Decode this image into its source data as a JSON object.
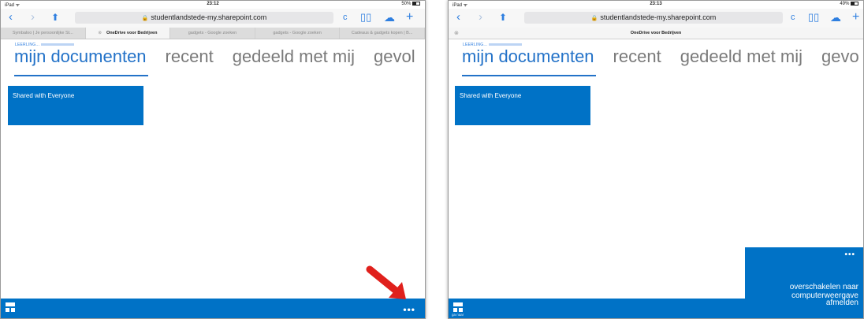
{
  "left": {
    "status": {
      "carrier": "iPad ᯤ",
      "time": "23:12",
      "battery": "50%"
    },
    "url": "studentlandstede-my.sharepoint.com",
    "tabs": [
      {
        "label": "Symbaloo | Je persoonlijke St...",
        "active": false
      },
      {
        "label": "OneDrive voor Bedrijven",
        "active": true
      },
      {
        "label": "gadgets - Google zoeken",
        "active": false
      },
      {
        "label": "gadgets - Google zoeken",
        "active": false
      },
      {
        "label": "Cadeaus & gadgets kopen | B...",
        "active": false
      }
    ],
    "user_label": "LEERLING...",
    "pivots": [
      "mijn documenten",
      "recent",
      "gedeeld met mij",
      "gevol"
    ],
    "tile_label": "Shared with Everyone",
    "ellipsis": "•••"
  },
  "right": {
    "status": {
      "carrier": "iPad ᯤ",
      "time": "23:13",
      "battery": "49%"
    },
    "url": "studentlandstede-my.sharepoint.com",
    "single_tab": "OneDrive voor Bedrijven",
    "user_label": "LEERLING...",
    "pivots": [
      "mijn documenten",
      "recent",
      "gedeeld met mij",
      "gevo"
    ],
    "tile_label": "Shared with Everyone",
    "goto_label": "ga naar",
    "menu": {
      "dots": "•••",
      "switch_line1": "overschakelen naar",
      "switch_line2": "computerweergave",
      "signout": "afmelden"
    }
  },
  "colors": {
    "accent": "#0072c6",
    "safari_blue": "#2f7fe0",
    "arrow": "#e0201c"
  },
  "icons": {
    "back": "chevron-left-icon",
    "forward": "chevron-right-icon",
    "share": "share-icon",
    "lock": "lock-icon",
    "reload": "reload-icon",
    "bookmarks": "book-icon",
    "cloud": "cloud-icon",
    "new_tab": "plus-icon",
    "menu": "tiles-menu-icon"
  }
}
